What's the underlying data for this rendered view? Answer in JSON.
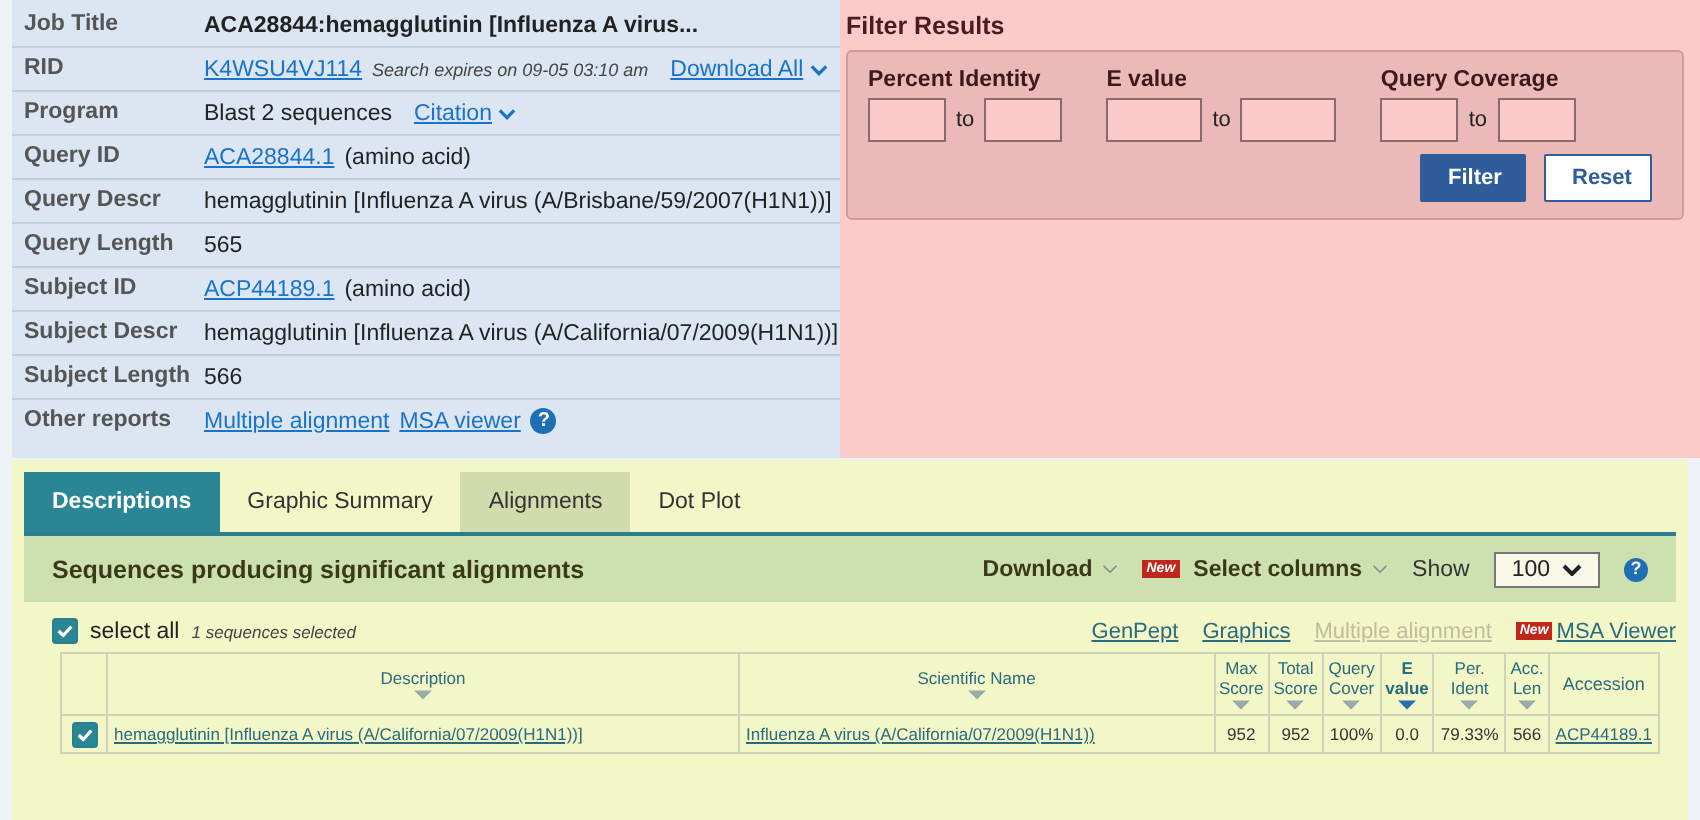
{
  "job_info": {
    "rows": [
      {
        "label": "Job Title",
        "parts": [
          {
            "kind": "title",
            "text": "ACA28844:hemagglutinin [Influenza A virus..."
          }
        ]
      },
      {
        "label": "RID",
        "parts": [
          {
            "kind": "link",
            "text": "K4WSU4VJ114"
          },
          {
            "kind": "note",
            "text": "Search expires on 09-05 03:10 am"
          },
          {
            "kind": "menu-link",
            "text": "Download All"
          }
        ]
      },
      {
        "label": "Program",
        "parts": [
          {
            "kind": "text",
            "text": "Blast 2 sequences"
          },
          {
            "kind": "menu-link",
            "text": "Citation"
          }
        ]
      },
      {
        "label": "Query ID",
        "parts": [
          {
            "kind": "link",
            "text": "ACA28844.1"
          },
          {
            "kind": "text",
            "text": "(amino acid)"
          }
        ]
      },
      {
        "label": "Query Descr",
        "parts": [
          {
            "kind": "text",
            "text": "hemagglutinin [Influenza A virus (A/Brisbane/59/2007(H1N1))]"
          }
        ]
      },
      {
        "label": "Query Length",
        "parts": [
          {
            "kind": "text",
            "text": "565"
          }
        ]
      },
      {
        "label": "Subject ID",
        "parts": [
          {
            "kind": "link",
            "text": "ACP44189.1"
          },
          {
            "kind": "text",
            "text": "(amino acid)"
          }
        ]
      },
      {
        "label": "Subject Descr",
        "parts": [
          {
            "kind": "text",
            "text": "hemagglutinin [Influenza A virus (A/California/07/2009(H1N1))]"
          }
        ]
      },
      {
        "label": "Subject Length",
        "parts": [
          {
            "kind": "text",
            "text": "566"
          }
        ]
      },
      {
        "label": "Other reports",
        "parts": [
          {
            "kind": "link",
            "text": "Multiple alignment"
          },
          {
            "kind": "link",
            "text": "MSA viewer"
          },
          {
            "kind": "help",
            "text": "?"
          }
        ]
      }
    ]
  },
  "filter": {
    "title": "Filter Results",
    "groups": [
      {
        "label": "Percent Identity",
        "joiner": "to"
      },
      {
        "label": "E value",
        "joiner": "to"
      },
      {
        "label": "Query Coverage",
        "joiner": "to"
      }
    ],
    "buttons": [
      {
        "label": "Filter",
        "kind": "primary"
      },
      {
        "label": "Reset",
        "kind": "secondary"
      }
    ]
  },
  "tabs": [
    {
      "label": "Descriptions",
      "selected": true,
      "hovered": false
    },
    {
      "label": "Graphic Summary",
      "selected": false,
      "hovered": false
    },
    {
      "label": "Alignments",
      "selected": false,
      "hovered": true
    },
    {
      "label": "Dot Plot",
      "selected": false,
      "hovered": false
    }
  ],
  "results": {
    "title": "Sequences producing significant alignments",
    "controls": [
      {
        "label": "Download",
        "kind": "menu"
      },
      {
        "label": "Select columns",
        "badge": "New",
        "kind": "menu"
      },
      {
        "label": "Show",
        "kind": "label"
      },
      {
        "label": "100",
        "kind": "select"
      },
      {
        "label": "?",
        "kind": "help"
      }
    ],
    "select_all": {
      "label": "select all",
      "checked": true,
      "note": "1 sequences selected"
    },
    "links": [
      {
        "label": "GenPept",
        "disabled": false
      },
      {
        "label": "Graphics",
        "disabled": false
      },
      {
        "label": "Multiple alignment",
        "disabled": true
      },
      {
        "label": "MSA Viewer",
        "disabled": false,
        "badge": "New"
      }
    ],
    "table": {
      "columns": [
        {
          "label": "Description",
          "kind": "text",
          "sortable": true,
          "sorted": false
        },
        {
          "label": "Scientific Name",
          "kind": "text",
          "sortable": true,
          "sorted": false
        },
        {
          "label": "Max Score",
          "kind": "num",
          "sortable": true,
          "sorted": false
        },
        {
          "label": "Total Score",
          "kind": "num",
          "sortable": true,
          "sorted": false
        },
        {
          "label": "Query Cover",
          "kind": "num",
          "sortable": true,
          "sorted": false
        },
        {
          "label": "E value",
          "kind": "num",
          "sortable": true,
          "sorted": true
        },
        {
          "label": "Per. Ident",
          "kind": "num",
          "sortable": true,
          "sorted": false
        },
        {
          "label": "Acc. Len",
          "kind": "num",
          "sortable": true,
          "sorted": false
        },
        {
          "label": "Accession",
          "kind": "num",
          "sortable": false,
          "sorted": false
        }
      ],
      "rows": [
        {
          "checked": true,
          "cells": [
            {
              "text": "hemagglutinin [Influenza A virus (A/California/07/2009(H1N1))]",
              "link": true
            },
            {
              "text": "Influenza A virus (A/California/07/2009(H1N1))",
              "link": true
            },
            {
              "text": "952",
              "link": false
            },
            {
              "text": "952",
              "link": false
            },
            {
              "text": "100%",
              "link": false
            },
            {
              "text": "0.0",
              "link": false
            },
            {
              "text": "79.33%",
              "link": false
            },
            {
              "text": "566",
              "link": false
            },
            {
              "text": "ACP44189.1",
              "link": true
            }
          ]
        }
      ]
    }
  }
}
